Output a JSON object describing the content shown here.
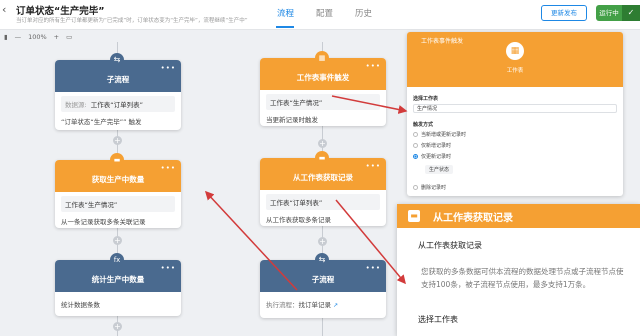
{
  "header": {
    "back_icon": "chevron-left-icon",
    "title": "订单状态“生产完毕”",
    "subtitle": "当订单对应的所有生产订单都更新为“已完成”时，订单状态变为“生产完毕”，流程继续“生产中”",
    "tabs": [
      "流程",
      "配置",
      "历史"
    ],
    "active_tab": "流程",
    "update_button": "更新发布",
    "status_button": "运行中",
    "accent": "#1e88e5",
    "status_color": "#43a047"
  },
  "zoombar": {
    "zoom": "100%",
    "minus": "—",
    "plus": "+"
  },
  "nodes": {
    "subflow1": {
      "title": "子流程",
      "field_label": "数据源:",
      "field_value": "工作表“订单列表”",
      "desc": "“订单状态“生产完毕”” 触发"
    },
    "fetch_count": {
      "title": "获取生产中数量",
      "field_value": "工作表“生产情况”",
      "desc": "从一条记录获取多条关联记录"
    },
    "stat_count": {
      "title": "统计生产中数量",
      "desc": "统计数据条数"
    },
    "sheet_trigger": {
      "title": "工作表事件触发",
      "field_value": "工作表“生产情况”",
      "desc": "当更新记录时触发"
    },
    "from_sheet": {
      "title": "从工作表获取记录",
      "field_value": "工作表“订单列表”",
      "desc": "从工作表获取多条记录"
    },
    "subflow2": {
      "title": "子流程",
      "label": "执行流程：",
      "value": "找订单记录"
    }
  },
  "panel": {
    "title": "工作表事件触发",
    "subtitle": "工作表",
    "section_sheet": "选择工作表",
    "sheet_value": "生产情况",
    "section_method": "触发方式",
    "options": [
      "当新增或更新记录时",
      "仅新增记录时",
      "仅更新记录时",
      "删除记录时"
    ],
    "selected_option": 2,
    "tag": "生产状态"
  },
  "zoom_card": {
    "title": "从工作表获取记录",
    "section1": "从工作表获取记录",
    "desc_line1": "您获取的多条数据可供本流程的数据处理节点或子流程节点使",
    "desc_line2": "支持100条，被子流程节点使用，最多支持1万条。",
    "section2": "选择工作表"
  }
}
